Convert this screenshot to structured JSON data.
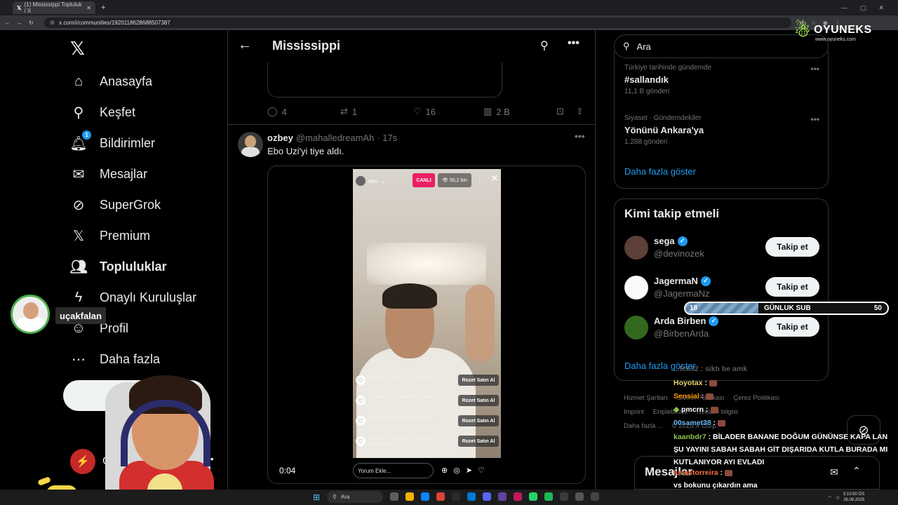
{
  "browser": {
    "tab_title": "(1) Mississippi Topluluk / X",
    "url": "x.com/i/communities/1920118628688507387"
  },
  "sidebar": {
    "items": [
      {
        "label": "Anasayfa",
        "icon": "home-icon"
      },
      {
        "label": "Keşfet",
        "icon": "search-icon"
      },
      {
        "label": "Bildirimler",
        "icon": "bell-icon",
        "badge": "1"
      },
      {
        "label": "Mesajlar",
        "icon": "mail-icon"
      },
      {
        "label": "SuperGrok",
        "icon": "grok-icon"
      },
      {
        "label": "Premium",
        "icon": "x-icon"
      },
      {
        "label": "Topluluklar",
        "icon": "communities-icon"
      },
      {
        "label": "Onaylı Kuruluşlar",
        "icon": "lightning-icon"
      },
      {
        "label": "Profil",
        "icon": "person-icon"
      },
      {
        "label": "Daha fazla",
        "icon": "more-circle-icon"
      }
    ],
    "post_button": "Gönder",
    "profile_initial": "C"
  },
  "main": {
    "title": "Mississippi",
    "prev_actions": {
      "replies": "4",
      "reposts": "1",
      "likes": "16",
      "views": "2 B"
    },
    "tweet": {
      "name": "ozbey",
      "handle": "@mahalledreamAh",
      "time": "· 17s",
      "text": "Ebo Uzi'yi tiye aldı.",
      "video_time": "0:04",
      "video_user": "ebo",
      "live_label": "CANLI",
      "viewers": "50,2 bin",
      "comment_placeholder": "Yorum Ekle...",
      "comments": [
        {
          "text": "alinimzy_31 bir rozet satın aldı.",
          "btn": "Rozet Satın Al"
        },
        {
          "text": "aramsiyar_taysun04 bir rozet satın aldı.",
          "btn": "Rozet Satın Al"
        },
        {
          "text": "enoyan.g bir rozet satın aldı.",
          "btn": "Rozet Satın Al"
        },
        {
          "text": "yigit.gbkn başka bir rozet daha satın aldı.",
          "btn": "Rozet Satın Al"
        }
      ]
    }
  },
  "right": {
    "search_placeholder": "Ara",
    "trends": [
      {
        "meta": "Türkiye tarihinde gündemde",
        "name": "#sallandık",
        "count": "11,1 B gönderi"
      },
      {
        "meta": "Siyaset · Gündemdekiler",
        "name": "Yönünü Ankara'ya",
        "count": "1.288 gönderi"
      }
    ],
    "show_more": "Daha fazla göster",
    "who_to_follow_title": "Kimi takip etmeli",
    "suggestions": [
      {
        "name": "sega",
        "handle": "@devinozek",
        "btn": "Takip et"
      },
      {
        "name": "JagermaN",
        "handle": "@JagermaNz",
        "btn": "Takip et"
      },
      {
        "name": "Arda Birben",
        "handle": "@BirbenArda",
        "btn": "Takip et"
      }
    ],
    "show_more2": "Daha fazla göster",
    "footer": [
      "Hizmet Şartları",
      "Gizlilik Politikası",
      "Çerez Politikası",
      "Imprint",
      "Erişilebilirlik",
      "Reklam bilgisi",
      "Daha fazla ...",
      "© 2025 X Corp."
    ]
  },
  "stream": {
    "logo_text": "OYUNEKS",
    "logo_url": "www.oyuneks.com",
    "overlay_name": "uçakfalan",
    "sub_goal": {
      "current": "18",
      "label": "GÜNLUK SUB",
      "max": "50",
      "progress": 0.36
    },
    "chat": [
      {
        "user": "...fck32",
        "text": ": siktı be amk",
        "faded": true
      },
      {
        "user": "Hoyotax",
        "text": ":",
        "color": "#e8d46b"
      },
      {
        "user": "Sensial",
        "text": ":",
        "color": "#ff9800"
      },
      {
        "user": "pmcrn",
        "text": ":",
        "color": "#ffffff"
      },
      {
        "user": "00samet38",
        "text": ":",
        "color": "#64b5f6"
      }
    ],
    "chat_long": [
      {
        "user": "kaanbdr7",
        "text": ": BİLADER BANANE DOĞUM GÜNÜNSE KAPA LAN ŞU YAYINI SABAH SABAH GİT DIŞARIDA KUTLA BURADA MI KUTLANIYOR AYI EVLADI",
        "color": "#8bc34a"
      },
      {
        "user": "lucastorreira",
        "text": ":",
        "color": "#ff7043"
      },
      {
        "user": "",
        "text": "vs bokunu çıkardın ama",
        "color": "#ffffff"
      }
    ]
  },
  "messages_drawer": {
    "title": "Mesajlar"
  },
  "taskbar": {
    "search": "Ara",
    "time": "3:10:50 ÖS",
    "date": "26.08.2025"
  }
}
